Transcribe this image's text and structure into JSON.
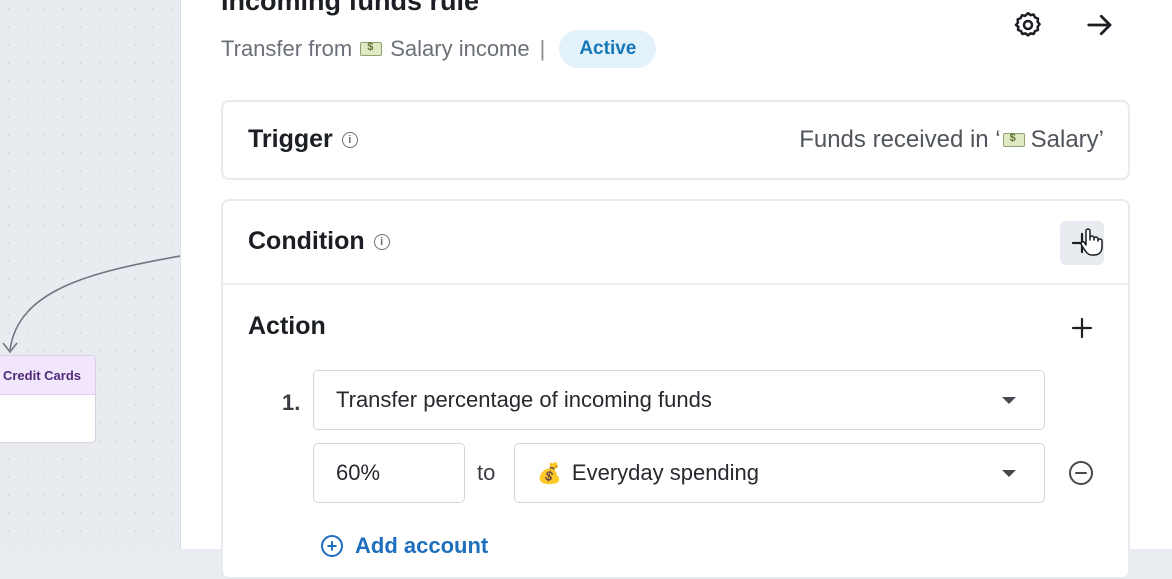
{
  "canvas": {
    "node_label": "Credit Cards"
  },
  "rule": {
    "title": "Incoming funds rule",
    "subtitle_prefix": "Transfer from",
    "subtitle_account": "Salary income",
    "subtitle_sep": "|",
    "status": "Active",
    "icons": {
      "settings": "gear-icon",
      "close": "arrow-right-icon"
    }
  },
  "trigger": {
    "label": "Trigger",
    "value_prefix": "Funds received in ‘",
    "value_account": "Salary’"
  },
  "condition": {
    "label": "Condition"
  },
  "action": {
    "label": "Action",
    "step_number": "1.",
    "type_value": "Transfer percentage of incoming funds",
    "percent_value": "60%",
    "to_label": "to",
    "account_icon": "💰",
    "account_value": "Everyday spending",
    "add_account_label": "Add account"
  },
  "colors": {
    "status_bg": "#e3f1fa",
    "status_text": "#1778b8",
    "link": "#1f6fbf",
    "node_header": "#f1e6fb"
  }
}
